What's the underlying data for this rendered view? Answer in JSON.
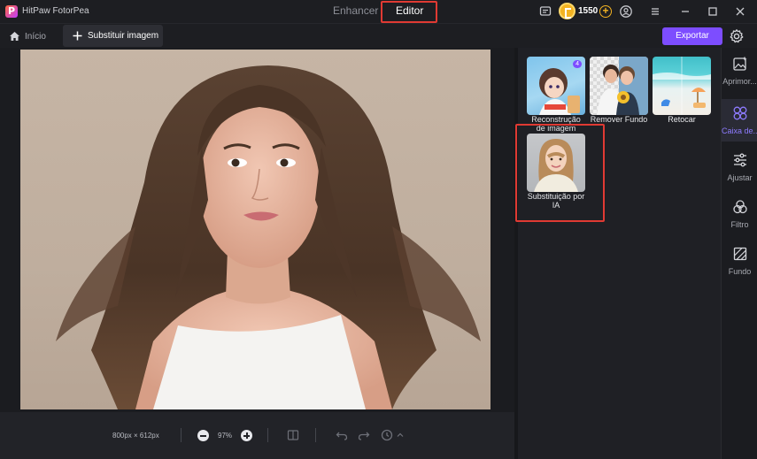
{
  "app": {
    "title": "HitPaw FotorPea",
    "modes": [
      "Enhancer",
      "Editor"
    ],
    "active_mode": "Editor",
    "coins": "1550"
  },
  "toolbar": {
    "home_label": "Início",
    "replace_label": "Substituir imagem",
    "export_label": "Exportar"
  },
  "canvas": {
    "dimensions": "800px × 612px",
    "zoom": "97%"
  },
  "tools": [
    {
      "label": "Reconstrução de imagem",
      "badge": "4"
    },
    {
      "label": "Remover Fundo"
    },
    {
      "label": "Retocar"
    },
    {
      "label": "Substituição por IA"
    }
  ],
  "sidenav": [
    {
      "label": "Aprimor...",
      "icon": "image-enhance-icon"
    },
    {
      "label": "Caixa de...",
      "icon": "toolbox-icon",
      "active": true
    },
    {
      "label": "Ajustar",
      "icon": "sliders-icon"
    },
    {
      "label": "Filtro",
      "icon": "filter-icon"
    },
    {
      "label": "Fundo",
      "icon": "background-icon"
    }
  ],
  "colors": {
    "accent": "#7d4dff",
    "highlight": "#e03a33",
    "coin": "#f3b322"
  }
}
